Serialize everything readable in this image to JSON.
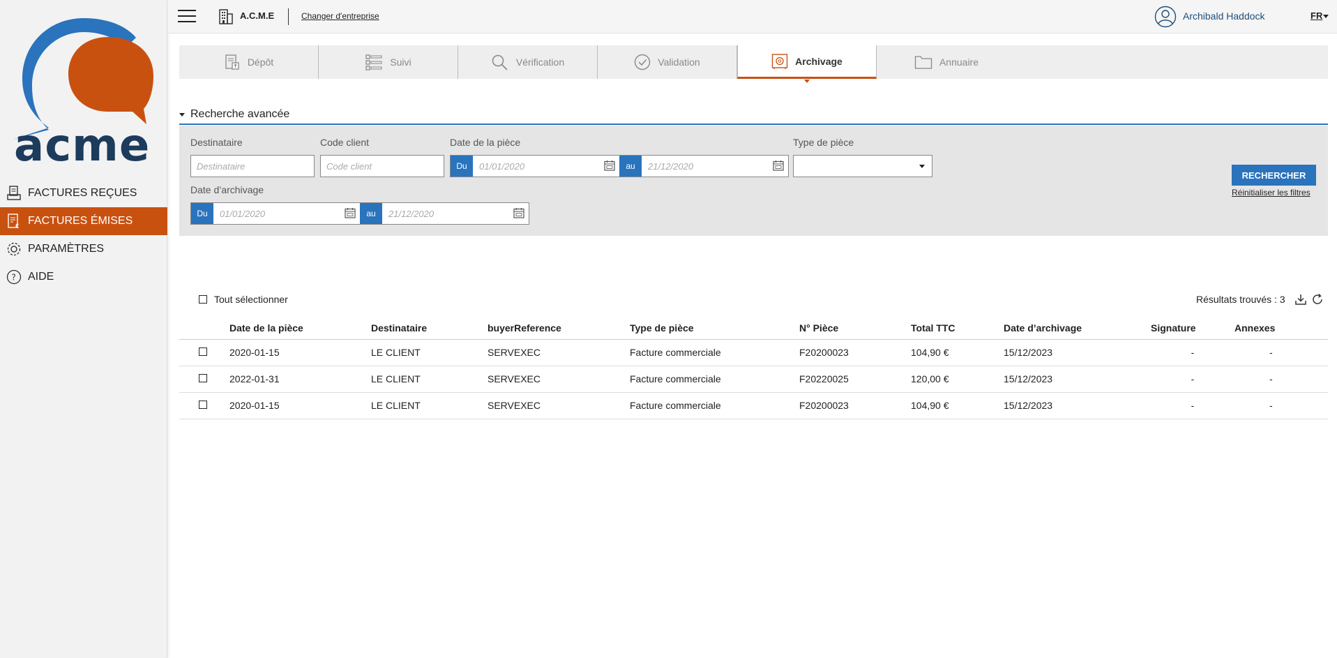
{
  "brand": {
    "logo_text": "acme",
    "accent_orange": "#c95110",
    "accent_blue": "#2a73bd",
    "navy": "#1d3b5c"
  },
  "topbar": {
    "company": "A.C.M.E",
    "change_company": "Changer d'entreprise",
    "user": "Archibald Haddock",
    "lang": "FR"
  },
  "sidebar": {
    "items": [
      {
        "label": "FACTURES REÇUES",
        "icon": "receipt-icon",
        "active": false
      },
      {
        "label": "FACTURES ÉMISES",
        "icon": "invoice-euro-icon",
        "active": true
      },
      {
        "label": "PARAMÈTRES",
        "icon": "gear-icon",
        "active": false
      },
      {
        "label": "AIDE",
        "icon": "help-icon",
        "active": false
      }
    ]
  },
  "tabs": [
    {
      "label": "Dépôt",
      "icon": "upload-doc-icon"
    },
    {
      "label": "Suivi",
      "icon": "list-icon"
    },
    {
      "label": "Vérification",
      "icon": "search-icon"
    },
    {
      "label": "Validation",
      "icon": "check-circle-icon"
    },
    {
      "label": "Archivage",
      "icon": "safe-icon",
      "active": true
    },
    {
      "label": "Annuaire",
      "icon": "folder-icon"
    }
  ],
  "search": {
    "title": "Recherche avancée",
    "destinataire_label": "Destinataire",
    "destinataire_placeholder": "Destinataire",
    "code_client_label": "Code client",
    "code_client_placeholder": "Code client",
    "date_piece_label": "Date de la pièce",
    "date_archivage_label": "Date d’archivage",
    "type_piece_label": "Type de pièce",
    "du": "Du",
    "au": "au",
    "date_from_placeholder": "01/01/2020",
    "date_to_placeholder": "21/12/2020",
    "search_button": "RECHERCHER",
    "reset_link": "Réinitialiser les filtres"
  },
  "results": {
    "select_all": "Tout sélectionner",
    "count_label": "Résultats trouvés : 3",
    "headers": [
      "Date de la pièce",
      "Destinataire",
      "buyerReference",
      "Type de pièce",
      "N° Pièce",
      "Total TTC",
      "Date d’archivage",
      "Signature",
      "Annexes"
    ],
    "rows": [
      [
        "2020-01-15",
        "LE CLIENT",
        "SERVEXEC",
        "Facture commerciale",
        "F20200023",
        "104,90 €",
        "15/12/2023",
        "-",
        "-"
      ],
      [
        "2022-01-31",
        "LE CLIENT",
        "SERVEXEC",
        "Facture commerciale",
        "F20220025",
        "120,00 €",
        "15/12/2023",
        "-",
        "-"
      ],
      [
        "2020-01-15",
        "LE CLIENT",
        "SERVEXEC",
        "Facture commerciale",
        "F20200023",
        "104,90 €",
        "15/12/2023",
        "-",
        "-"
      ]
    ]
  }
}
